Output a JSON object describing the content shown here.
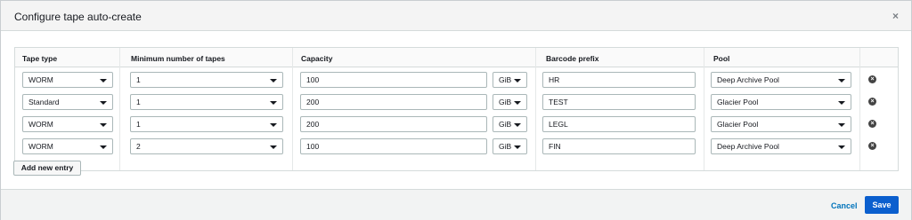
{
  "dialog": {
    "title": "Configure tape auto-create",
    "close_icon": "close-icon"
  },
  "table": {
    "headers": {
      "tape_type": "Tape type",
      "min_tapes": "Minimum number of tapes",
      "capacity": "Capacity",
      "barcode_prefix": "Barcode prefix",
      "pool": "Pool"
    },
    "rows": [
      {
        "tape_type": "WORM",
        "min_tapes": "1",
        "capacity": "100",
        "unit": "GiB",
        "barcode_prefix": "HR",
        "pool": "Deep Archive Pool"
      },
      {
        "tape_type": "Standard",
        "min_tapes": "1",
        "capacity": "200",
        "unit": "GiB",
        "barcode_prefix": "TEST",
        "pool": "Glacier Pool"
      },
      {
        "tape_type": "WORM",
        "min_tapes": "1",
        "capacity": "200",
        "unit": "GiB",
        "barcode_prefix": "LEGL",
        "pool": "Glacier Pool"
      },
      {
        "tape_type": "WORM",
        "min_tapes": "2",
        "capacity": "100",
        "unit": "GiB",
        "barcode_prefix": "FIN",
        "pool": "Deep Archive Pool"
      }
    ]
  },
  "actions": {
    "add_entry_label": "Add new entry",
    "cancel_label": "Cancel",
    "save_label": "Save"
  },
  "colors": {
    "primary": "#0b5fce",
    "link": "#0073bb"
  }
}
